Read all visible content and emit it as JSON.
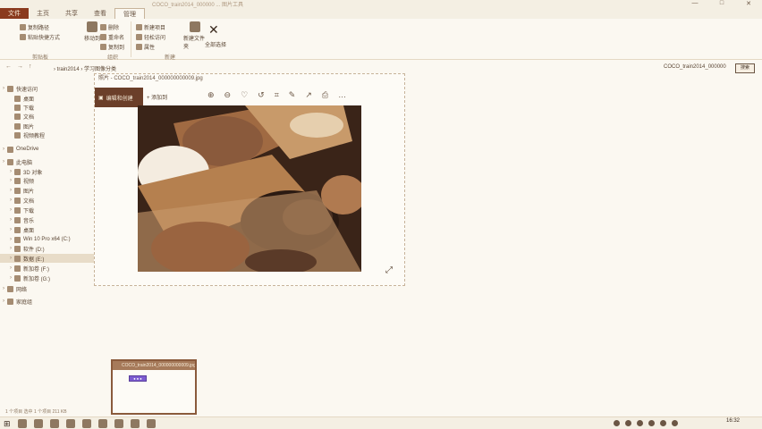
{
  "window": {
    "title": "COCO_train2014_000000 ... 图片工具",
    "controls": [
      "—",
      "□",
      "✕"
    ]
  },
  "ribbon_tabs": [
    "文件",
    "主页",
    "共享",
    "查看",
    "管理"
  ],
  "ribbon": {
    "copy_path": "复制路径",
    "paste_shortcut": "粘贴快捷方式",
    "move_to": "移动到",
    "copy_to": "复制到",
    "delete": "删除",
    "rename": "重命名",
    "new_folder": "新建文件夹",
    "new_item": "新建项目",
    "easy_access": "轻松访问",
    "properties": "属性",
    "open": "打开",
    "edit": "编辑",
    "history": "历史记录",
    "select_all": "全部选择",
    "select_none": "全部取消",
    "invert_selection": "反向选择",
    "group_clipboard": "剪贴板",
    "group_organize": "组织",
    "group_new": "新建",
    "group_open": "打开",
    "group_select": "选择"
  },
  "address": {
    "path": "› train2014 › 学习图像分类",
    "search_text": "COCO_train2014_000000",
    "search_button": "搜索"
  },
  "sidebar": {
    "items": [
      {
        "label": "快速访问",
        "chev": "›"
      },
      {
        "label": "桌面",
        "chev": ""
      },
      {
        "label": "下载",
        "chev": ""
      },
      {
        "label": "文档",
        "chev": ""
      },
      {
        "label": "图片",
        "chev": ""
      },
      {
        "label": "视频教程",
        "chev": ""
      },
      {
        "label": "OneDrive",
        "chev": "›"
      },
      {
        "label": "此电脑",
        "chev": "›"
      },
      {
        "label": "3D 对象",
        "chev": "›"
      },
      {
        "label": "视频",
        "chev": "›"
      },
      {
        "label": "图片",
        "chev": "›"
      },
      {
        "label": "文档",
        "chev": "›"
      },
      {
        "label": "下载",
        "chev": "›"
      },
      {
        "label": "音乐",
        "chev": "›"
      },
      {
        "label": "桌面",
        "chev": "›"
      },
      {
        "label": "Win 10 Pro x64 (C:)",
        "chev": "›"
      },
      {
        "label": "软件 (D:)",
        "chev": "›"
      },
      {
        "label": "数据 (E:)",
        "chev": "›"
      },
      {
        "label": "新加卷 (F:)",
        "chev": "›"
      },
      {
        "label": "新加卷 (G:)",
        "chev": "›"
      },
      {
        "label": "网络",
        "chev": "›"
      },
      {
        "label": "家庭组",
        "chev": "›"
      }
    ]
  },
  "preview": {
    "title": "照片 - COCO_train2014_000000000009.jpg",
    "edit_button": "编辑和创建",
    "add_button": "添加到",
    "tools": [
      "⊕",
      "⊖",
      "♡",
      "↺",
      "⌗",
      "✎",
      "↗",
      "⎙",
      "…"
    ],
    "expand": "⤢"
  },
  "mini_window": {
    "title": "COCO_train2014_000000000009.jpg",
    "badge": "● ● ●"
  },
  "status": {
    "text": "1 个项目   选中 1 个项目  211 KB"
  },
  "taskbar": {
    "start": "⊞",
    "clock": "16:32"
  }
}
